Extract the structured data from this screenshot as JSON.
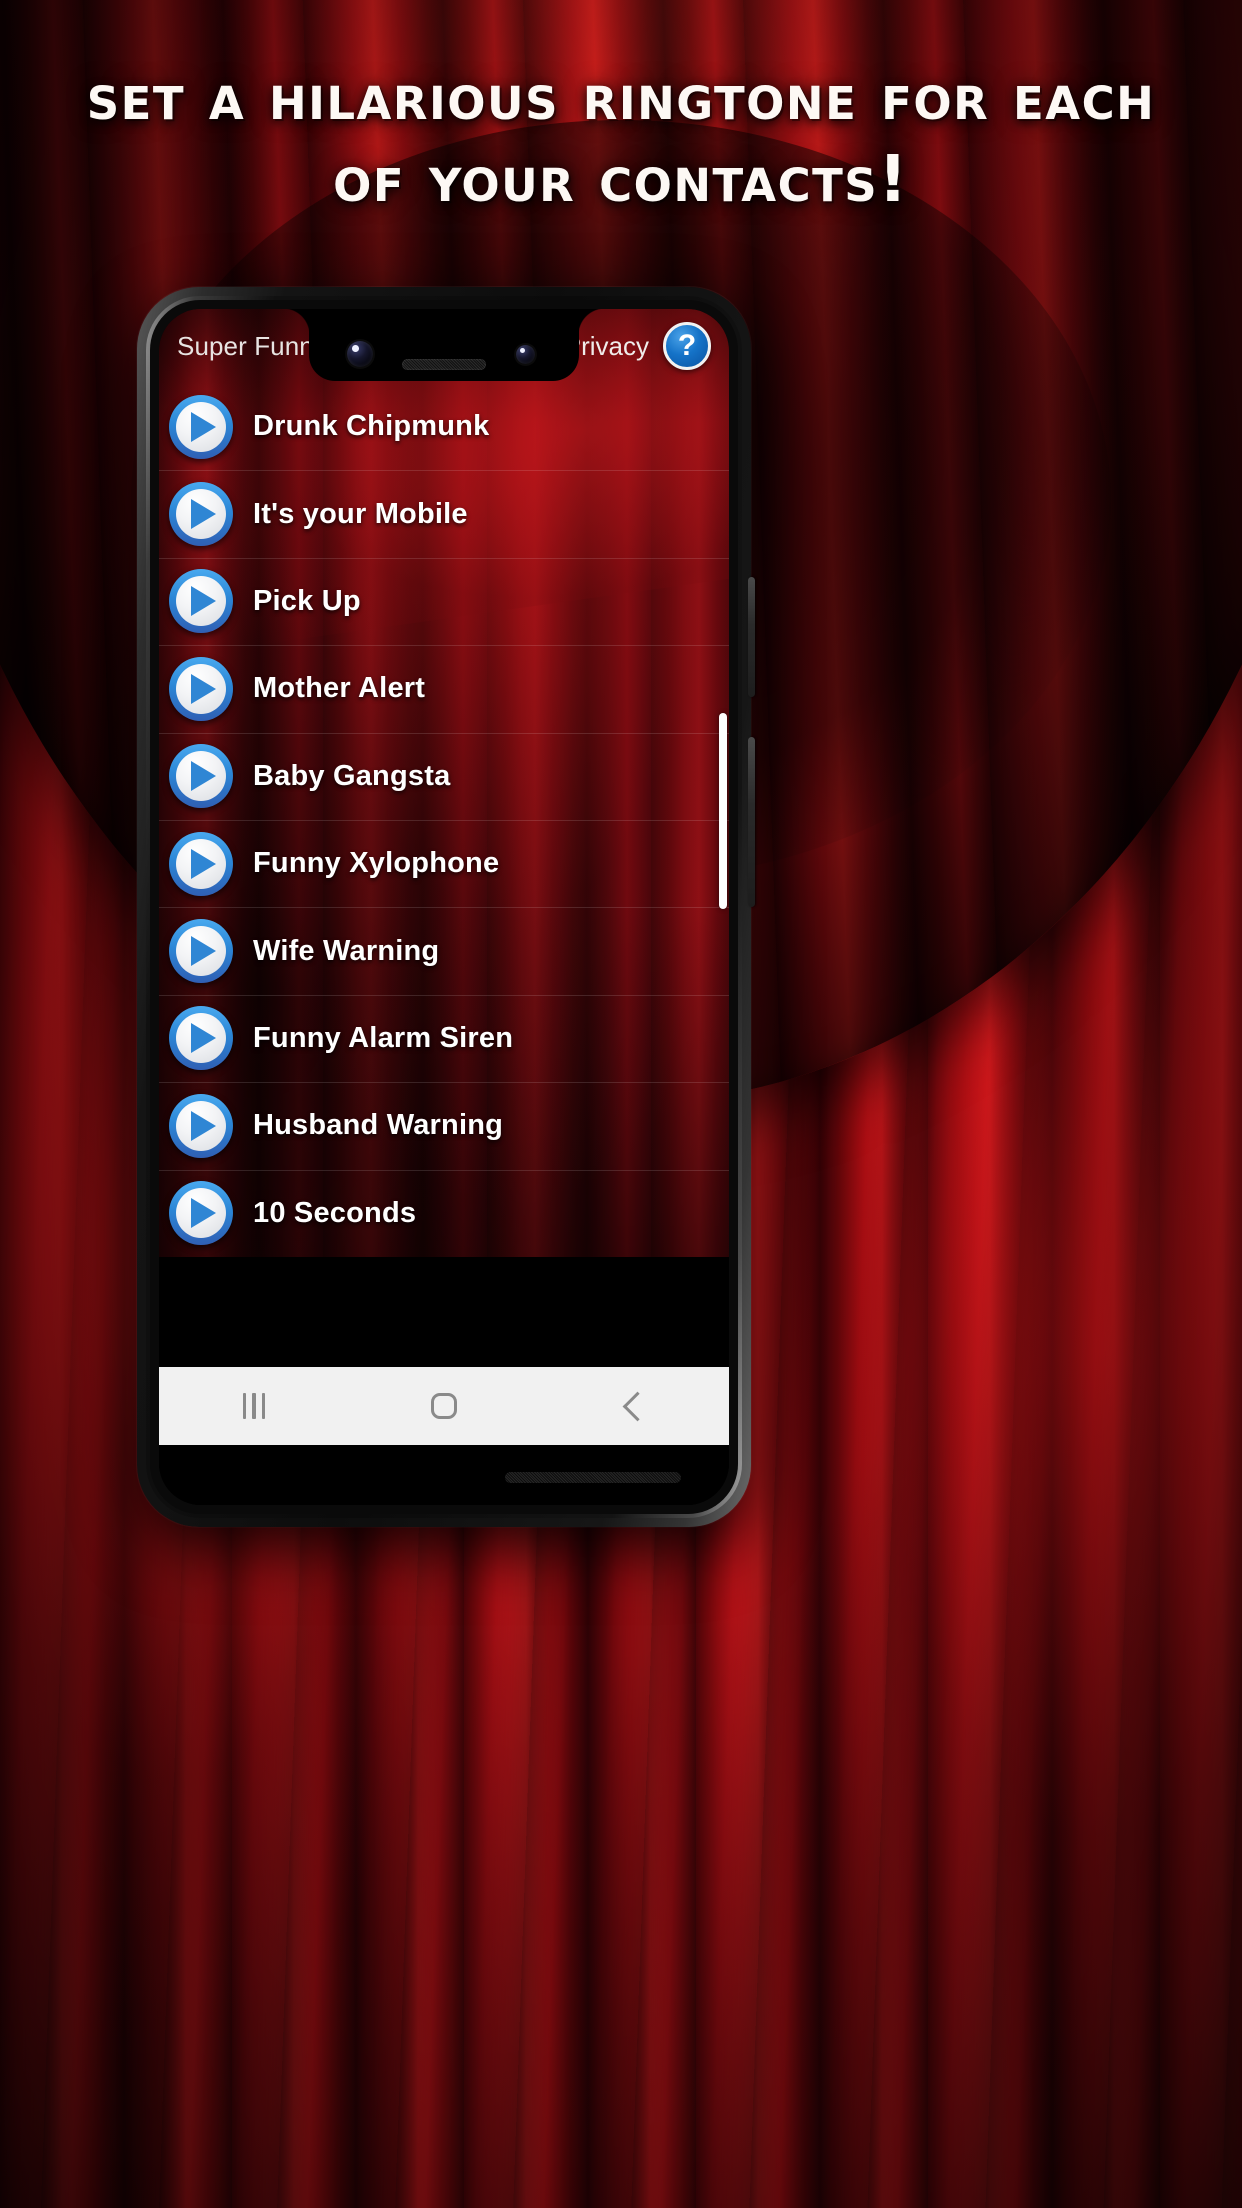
{
  "promo": {
    "headline_line1": "Set a hilarious ringtone for each",
    "headline_line2": "of your contacts!"
  },
  "app": {
    "title": "Super Funny Ring",
    "privacy_label": "Privacy",
    "help_icon_glyph": "?",
    "ringtones": [
      {
        "name": "Drunk Chipmunk"
      },
      {
        "name": "It's your Mobile"
      },
      {
        "name": "Pick Up"
      },
      {
        "name": "Mother Alert"
      },
      {
        "name": "Baby Gangsta"
      },
      {
        "name": "Funny Xylophone"
      },
      {
        "name": "Wife Warning"
      },
      {
        "name": "Funny Alarm Siren"
      },
      {
        "name": "Husband Warning"
      },
      {
        "name": "10 Seconds"
      }
    ]
  },
  "navbar": {
    "recents_icon": "recents-icon",
    "home_icon": "home-icon",
    "back_icon": "back-icon"
  },
  "colors": {
    "accent_blue": "#2b86d6",
    "curtain_red": "#c21419",
    "navbar_bg": "#f1f1f1",
    "text_white": "#ffffff"
  }
}
